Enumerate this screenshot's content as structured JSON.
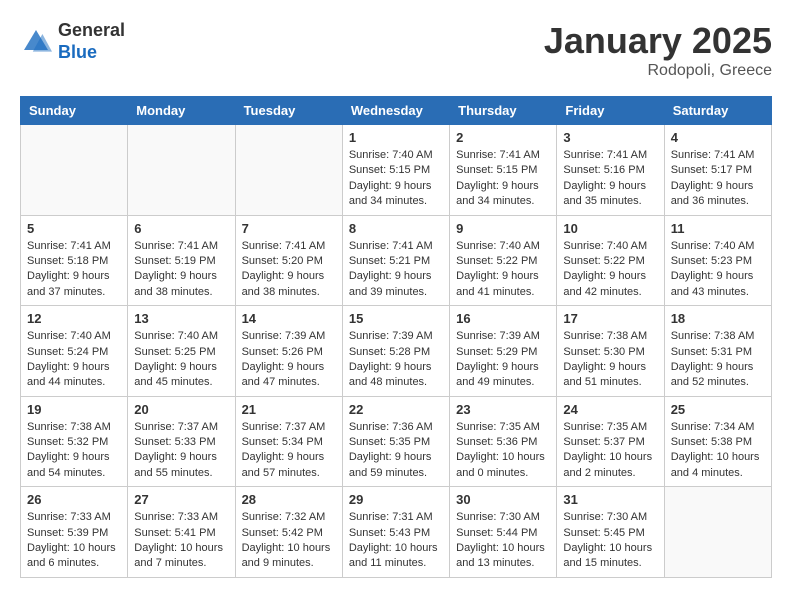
{
  "header": {
    "logo_general": "General",
    "logo_blue": "Blue",
    "title": "January 2025",
    "subtitle": "Rodopoli, Greece"
  },
  "days_of_week": [
    "Sunday",
    "Monday",
    "Tuesday",
    "Wednesday",
    "Thursday",
    "Friday",
    "Saturday"
  ],
  "weeks": [
    [
      {
        "day": "",
        "info": ""
      },
      {
        "day": "",
        "info": ""
      },
      {
        "day": "",
        "info": ""
      },
      {
        "day": "1",
        "info": "Sunrise: 7:40 AM\nSunset: 5:15 PM\nDaylight: 9 hours\nand 34 minutes."
      },
      {
        "day": "2",
        "info": "Sunrise: 7:41 AM\nSunset: 5:15 PM\nDaylight: 9 hours\nand 34 minutes."
      },
      {
        "day": "3",
        "info": "Sunrise: 7:41 AM\nSunset: 5:16 PM\nDaylight: 9 hours\nand 35 minutes."
      },
      {
        "day": "4",
        "info": "Sunrise: 7:41 AM\nSunset: 5:17 PM\nDaylight: 9 hours\nand 36 minutes."
      }
    ],
    [
      {
        "day": "5",
        "info": "Sunrise: 7:41 AM\nSunset: 5:18 PM\nDaylight: 9 hours\nand 37 minutes."
      },
      {
        "day": "6",
        "info": "Sunrise: 7:41 AM\nSunset: 5:19 PM\nDaylight: 9 hours\nand 38 minutes."
      },
      {
        "day": "7",
        "info": "Sunrise: 7:41 AM\nSunset: 5:20 PM\nDaylight: 9 hours\nand 38 minutes."
      },
      {
        "day": "8",
        "info": "Sunrise: 7:41 AM\nSunset: 5:21 PM\nDaylight: 9 hours\nand 39 minutes."
      },
      {
        "day": "9",
        "info": "Sunrise: 7:40 AM\nSunset: 5:22 PM\nDaylight: 9 hours\nand 41 minutes."
      },
      {
        "day": "10",
        "info": "Sunrise: 7:40 AM\nSunset: 5:22 PM\nDaylight: 9 hours\nand 42 minutes."
      },
      {
        "day": "11",
        "info": "Sunrise: 7:40 AM\nSunset: 5:23 PM\nDaylight: 9 hours\nand 43 minutes."
      }
    ],
    [
      {
        "day": "12",
        "info": "Sunrise: 7:40 AM\nSunset: 5:24 PM\nDaylight: 9 hours\nand 44 minutes."
      },
      {
        "day": "13",
        "info": "Sunrise: 7:40 AM\nSunset: 5:25 PM\nDaylight: 9 hours\nand 45 minutes."
      },
      {
        "day": "14",
        "info": "Sunrise: 7:39 AM\nSunset: 5:26 PM\nDaylight: 9 hours\nand 47 minutes."
      },
      {
        "day": "15",
        "info": "Sunrise: 7:39 AM\nSunset: 5:28 PM\nDaylight: 9 hours\nand 48 minutes."
      },
      {
        "day": "16",
        "info": "Sunrise: 7:39 AM\nSunset: 5:29 PM\nDaylight: 9 hours\nand 49 minutes."
      },
      {
        "day": "17",
        "info": "Sunrise: 7:38 AM\nSunset: 5:30 PM\nDaylight: 9 hours\nand 51 minutes."
      },
      {
        "day": "18",
        "info": "Sunrise: 7:38 AM\nSunset: 5:31 PM\nDaylight: 9 hours\nand 52 minutes."
      }
    ],
    [
      {
        "day": "19",
        "info": "Sunrise: 7:38 AM\nSunset: 5:32 PM\nDaylight: 9 hours\nand 54 minutes."
      },
      {
        "day": "20",
        "info": "Sunrise: 7:37 AM\nSunset: 5:33 PM\nDaylight: 9 hours\nand 55 minutes."
      },
      {
        "day": "21",
        "info": "Sunrise: 7:37 AM\nSunset: 5:34 PM\nDaylight: 9 hours\nand 57 minutes."
      },
      {
        "day": "22",
        "info": "Sunrise: 7:36 AM\nSunset: 5:35 PM\nDaylight: 9 hours\nand 59 minutes."
      },
      {
        "day": "23",
        "info": "Sunrise: 7:35 AM\nSunset: 5:36 PM\nDaylight: 10 hours\nand 0 minutes."
      },
      {
        "day": "24",
        "info": "Sunrise: 7:35 AM\nSunset: 5:37 PM\nDaylight: 10 hours\nand 2 minutes."
      },
      {
        "day": "25",
        "info": "Sunrise: 7:34 AM\nSunset: 5:38 PM\nDaylight: 10 hours\nand 4 minutes."
      }
    ],
    [
      {
        "day": "26",
        "info": "Sunrise: 7:33 AM\nSunset: 5:39 PM\nDaylight: 10 hours\nand 6 minutes."
      },
      {
        "day": "27",
        "info": "Sunrise: 7:33 AM\nSunset: 5:41 PM\nDaylight: 10 hours\nand 7 minutes."
      },
      {
        "day": "28",
        "info": "Sunrise: 7:32 AM\nSunset: 5:42 PM\nDaylight: 10 hours\nand 9 minutes."
      },
      {
        "day": "29",
        "info": "Sunrise: 7:31 AM\nSunset: 5:43 PM\nDaylight: 10 hours\nand 11 minutes."
      },
      {
        "day": "30",
        "info": "Sunrise: 7:30 AM\nSunset: 5:44 PM\nDaylight: 10 hours\nand 13 minutes."
      },
      {
        "day": "31",
        "info": "Sunrise: 7:30 AM\nSunset: 5:45 PM\nDaylight: 10 hours\nand 15 minutes."
      },
      {
        "day": "",
        "info": ""
      }
    ]
  ]
}
